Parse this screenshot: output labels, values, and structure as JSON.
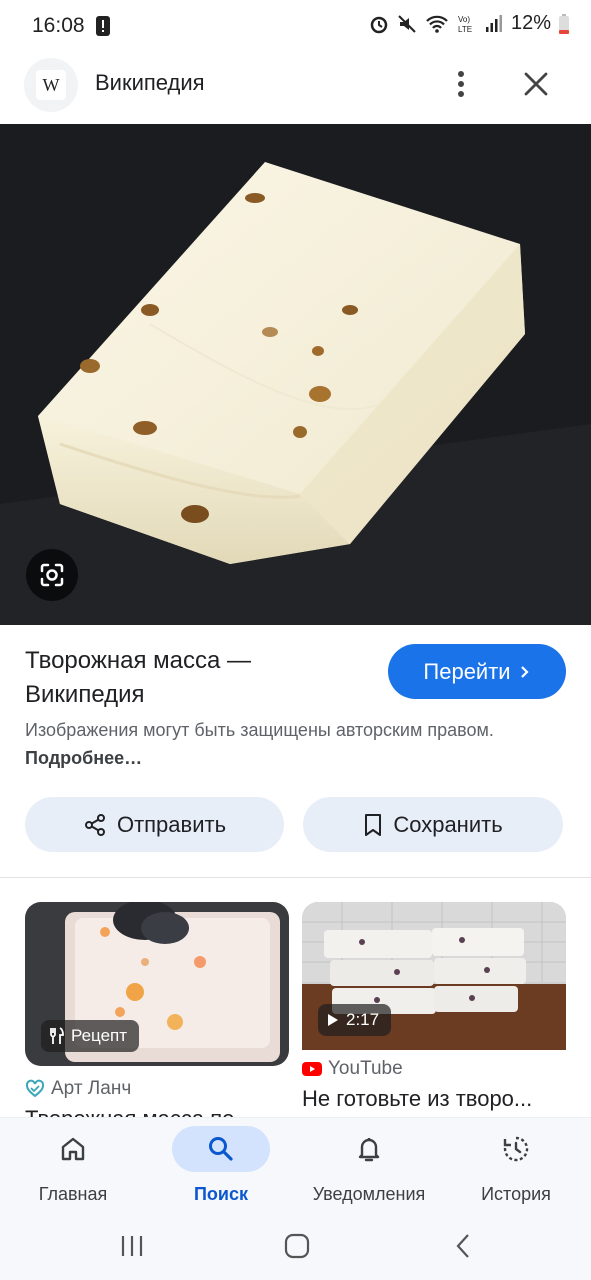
{
  "status": {
    "time": "16:08",
    "battery": "12%"
  },
  "header": {
    "site_name": "Википедия"
  },
  "result": {
    "title": "Творожная масса — Википедия",
    "go_label": "Перейти",
    "copyright_text": "Изображения могут быть защищены авторским правом.",
    "more_label": "Подробнее…",
    "share_label": "Отправить",
    "save_label": "Сохранить"
  },
  "related": [
    {
      "badge": "Рецепт",
      "source": "Арт Ланч",
      "title": "Творожная масса по..."
    },
    {
      "badge": "2:17",
      "source": "YouTube",
      "title": "Не готовьте из творо..."
    }
  ],
  "bottom_nav": [
    {
      "label": "Главная",
      "icon": "home-icon"
    },
    {
      "label": "Поиск",
      "icon": "search-icon",
      "active": true
    },
    {
      "label": "Уведомления",
      "icon": "bell-icon"
    },
    {
      "label": "История",
      "icon": "history-icon"
    }
  ],
  "colors": {
    "accent": "#1a73e8",
    "pill_bg": "#e8eef8",
    "nav_active_bg": "#d3e3fd"
  }
}
